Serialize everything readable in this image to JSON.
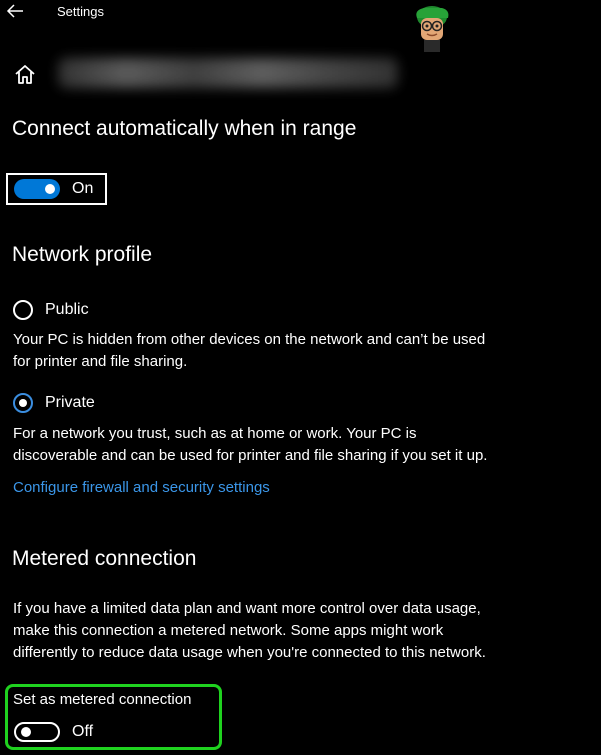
{
  "window": {
    "title": "Settings"
  },
  "header": {
    "back_icon": "back-arrow-icon",
    "home_icon": "home-icon",
    "network_name_blurred": ""
  },
  "auto_connect": {
    "heading": "Connect automatically when in range",
    "toggle_state": "On",
    "toggle_on": true
  },
  "network_profile": {
    "heading": "Network profile",
    "options": [
      {
        "label": "Public",
        "selected": false,
        "description_lines": [
          "Your PC is hidden from other devices on the network and can’t be used",
          "for printer and file sharing."
        ]
      },
      {
        "label": "Private",
        "selected": true,
        "description_lines": [
          "For a network you trust, such as at home or work. Your PC is",
          "discoverable and can be used for printer and file sharing if you set it up."
        ]
      }
    ],
    "link_label": "Configure firewall and security settings"
  },
  "metered": {
    "heading": "Metered connection",
    "description_lines": [
      "If you have a limited data plan and want more control over data usage,",
      "make this connection a metered network. Some apps might work",
      "differently to reduce data usage when you're connected to this network."
    ],
    "setting_label": "Set as metered connection",
    "toggle_state": "Off",
    "toggle_on": false
  },
  "colors": {
    "background": "#000000",
    "accent": "#0078d7",
    "link": "#3b96e8",
    "highlight_box": "#1fd21f"
  }
}
